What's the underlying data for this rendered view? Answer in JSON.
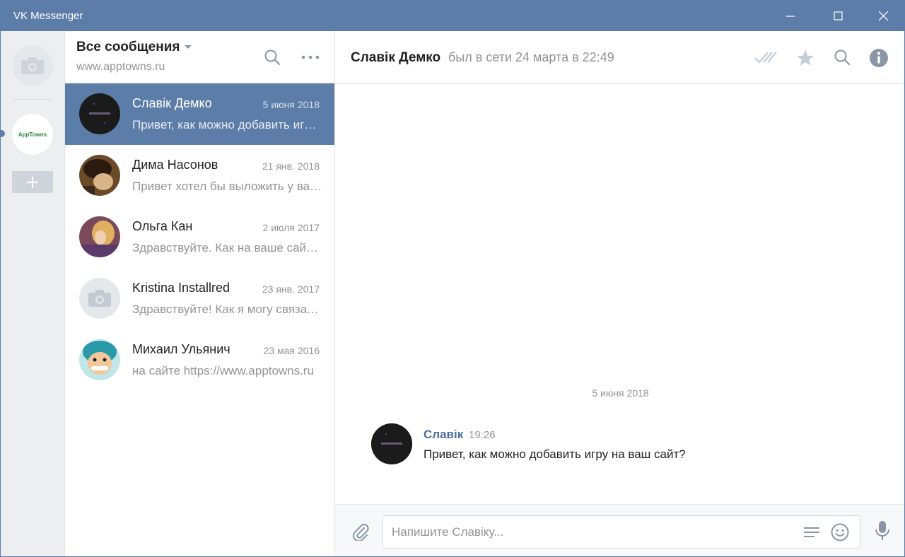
{
  "window": {
    "title": "VK Messenger"
  },
  "rail": {
    "account_logo_text": "AppTowns"
  },
  "dialog_list": {
    "title": "Все сообщения",
    "subtitle": "www.apptowns.ru",
    "dialogs": [
      {
        "name": "Славік Демко",
        "date": "5 июня 2018",
        "preview": "Привет, как можно добавить игру на ваш сайт?",
        "active": true
      },
      {
        "name": "Дима Насонов",
        "date": "21 янв. 2018",
        "preview": "Привет хотел бы выложить у вас игру",
        "active": false
      },
      {
        "name": "Ольга Кан",
        "date": "2 июля 2017",
        "preview": "Здравствуйте. Как на ваше сайт добавить",
        "active": false
      },
      {
        "name": "Kristina Installred",
        "date": "23 янв. 2017",
        "preview": "Здравствуйте! Как я могу связаться",
        "active": false
      },
      {
        "name": "Михаил Ульянич",
        "date": "23 мая 2016",
        "preview": "на сайте https://www.apptowns.ru",
        "active": false
      }
    ]
  },
  "chat": {
    "name": "Славік Демко",
    "status": "был в сети 24 марта в 22:49",
    "date_separator": "5 июня 2018",
    "message": {
      "author": "Славік",
      "time": "19:26",
      "text": "Привет, как можно добавить игру на ваш сайт?"
    },
    "composer_placeholder": "Напишите Славіку..."
  },
  "colors": {
    "accent": "#5b7da8",
    "muted": "#939393",
    "author": "#4a6f9f"
  }
}
